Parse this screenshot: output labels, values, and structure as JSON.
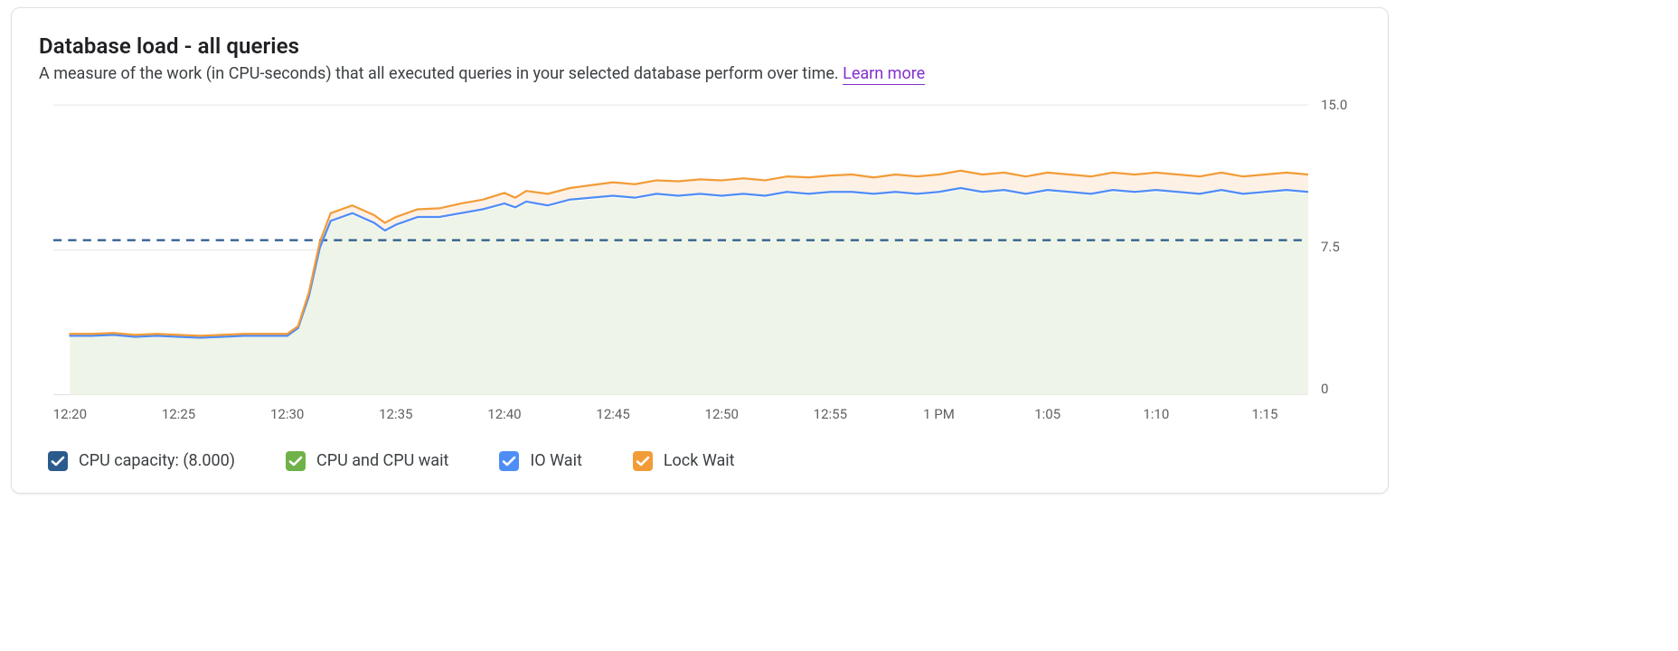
{
  "card": {
    "title": "Database load - all queries",
    "description": "A measure of the work (in CPU-seconds) that all executed queries in your selected database perform over time.",
    "learn_more": "Learn more"
  },
  "colors": {
    "cpu_capacity": "#2b5a8c",
    "cpu_wait": "#6fb24a",
    "cpu_wait_fill": "#eef4e7",
    "io_wait": "#4f8df6",
    "lock_wait": "#f29c38",
    "lock_wait_fill": "#fdf1e6"
  },
  "legend": {
    "cpu_capacity": "CPU capacity: (8.000)",
    "cpu_wait": "CPU and CPU wait",
    "io_wait": "IO Wait",
    "lock_wait": "Lock Wait"
  },
  "chart_data": {
    "type": "area",
    "title": "Database load - all queries",
    "xlabel": "",
    "ylabel": "",
    "ylim": [
      0,
      15
    ],
    "y_ticks": [
      0,
      7.5,
      15.0
    ],
    "y_tick_labels": [
      "0",
      "7.5",
      "15.0"
    ],
    "x_tick_labels": [
      "12:20",
      "12:25",
      "12:30",
      "12:35",
      "12:40",
      "12:45",
      "12:50",
      "12:55",
      "1 PM",
      "1:05",
      "1:10",
      "1:15"
    ],
    "x_tick_minutes": [
      0,
      5,
      10,
      15,
      20,
      25,
      30,
      35,
      40,
      45,
      50,
      55
    ],
    "x_range_minutes": [
      0,
      57
    ],
    "cpu_capacity": 8.0,
    "series": [
      {
        "name": "CPU and CPU wait",
        "stack_order": 0,
        "x_minutes": [
          0,
          1,
          2,
          3,
          4,
          5,
          6,
          7,
          8,
          9,
          10,
          10.5,
          11,
          11.5,
          12,
          13,
          14,
          14.5,
          15,
          16,
          17,
          18,
          19,
          20,
          20.5,
          21,
          22,
          23,
          24,
          25,
          26,
          27,
          28,
          29,
          30,
          31,
          32,
          33,
          34,
          35,
          36,
          37,
          38,
          39,
          40,
          41,
          42,
          43,
          44,
          45,
          46,
          47,
          48,
          49,
          50,
          51,
          52,
          53,
          54,
          55,
          56,
          57
        ],
        "values": [
          3.0,
          3.0,
          3.05,
          2.95,
          3.0,
          2.95,
          2.9,
          2.95,
          3.0,
          3.0,
          3.0,
          3.4,
          5.0,
          7.5,
          8.9,
          9.3,
          8.8,
          8.4,
          8.7,
          9.1,
          9.1,
          9.3,
          9.5,
          9.8,
          9.6,
          9.9,
          9.7,
          10.0,
          10.1,
          10.2,
          10.1,
          10.3,
          10.2,
          10.3,
          10.2,
          10.3,
          10.2,
          10.4,
          10.3,
          10.4,
          10.4,
          10.3,
          10.4,
          10.3,
          10.4,
          10.6,
          10.4,
          10.5,
          10.3,
          10.5,
          10.4,
          10.3,
          10.5,
          10.4,
          10.5,
          10.4,
          10.3,
          10.5,
          10.3,
          10.4,
          10.5,
          10.4
        ]
      },
      {
        "name": "IO Wait",
        "stack_order": 1,
        "x_minutes": [
          0,
          1,
          2,
          3,
          4,
          5,
          6,
          7,
          8,
          9,
          10,
          10.5,
          11,
          11.5,
          12,
          13,
          14,
          14.5,
          15,
          16,
          17,
          18,
          19,
          20,
          20.5,
          21,
          22,
          23,
          24,
          25,
          26,
          27,
          28,
          29,
          30,
          31,
          32,
          33,
          34,
          35,
          36,
          37,
          38,
          39,
          40,
          41,
          42,
          43,
          44,
          45,
          46,
          47,
          48,
          49,
          50,
          51,
          52,
          53,
          54,
          55,
          56,
          57
        ],
        "values": [
          0.05,
          0.05,
          0.05,
          0.05,
          0.05,
          0.05,
          0.05,
          0.05,
          0.05,
          0.05,
          0.05,
          0.05,
          0.1,
          0.1,
          0.1,
          0.1,
          0.1,
          0.1,
          0.1,
          0.1,
          0.1,
          0.1,
          0.1,
          0.1,
          0.1,
          0.1,
          0.1,
          0.1,
          0.1,
          0.1,
          0.1,
          0.1,
          0.1,
          0.1,
          0.1,
          0.1,
          0.1,
          0.1,
          0.1,
          0.1,
          0.1,
          0.1,
          0.1,
          0.1,
          0.1,
          0.1,
          0.1,
          0.1,
          0.1,
          0.1,
          0.1,
          0.1,
          0.1,
          0.1,
          0.1,
          0.1,
          0.1,
          0.1,
          0.1,
          0.1,
          0.1,
          0.1
        ]
      },
      {
        "name": "Lock Wait",
        "stack_order": 2,
        "x_minutes": [
          0,
          1,
          2,
          3,
          4,
          5,
          6,
          7,
          8,
          9,
          10,
          10.5,
          11,
          11.5,
          12,
          13,
          14,
          14.5,
          15,
          16,
          17,
          18,
          19,
          20,
          20.5,
          21,
          22,
          23,
          24,
          25,
          26,
          27,
          28,
          29,
          30,
          31,
          32,
          33,
          34,
          35,
          36,
          37,
          38,
          39,
          40,
          41,
          42,
          43,
          44,
          45,
          46,
          47,
          48,
          49,
          50,
          51,
          52,
          53,
          54,
          55,
          56,
          57
        ],
        "values": [
          0.1,
          0.1,
          0.1,
          0.1,
          0.1,
          0.1,
          0.1,
          0.1,
          0.1,
          0.1,
          0.1,
          0.1,
          0.2,
          0.3,
          0.4,
          0.4,
          0.4,
          0.4,
          0.4,
          0.4,
          0.45,
          0.5,
          0.5,
          0.55,
          0.5,
          0.55,
          0.6,
          0.6,
          0.65,
          0.7,
          0.7,
          0.7,
          0.75,
          0.75,
          0.8,
          0.8,
          0.8,
          0.8,
          0.85,
          0.85,
          0.9,
          0.85,
          0.9,
          0.9,
          0.9,
          0.9,
          0.9,
          0.9,
          0.9,
          0.9,
          0.9,
          0.9,
          0.9,
          0.9,
          0.9,
          0.9,
          0.9,
          0.9,
          0.9,
          0.9,
          0.9,
          0.9
        ]
      }
    ]
  }
}
